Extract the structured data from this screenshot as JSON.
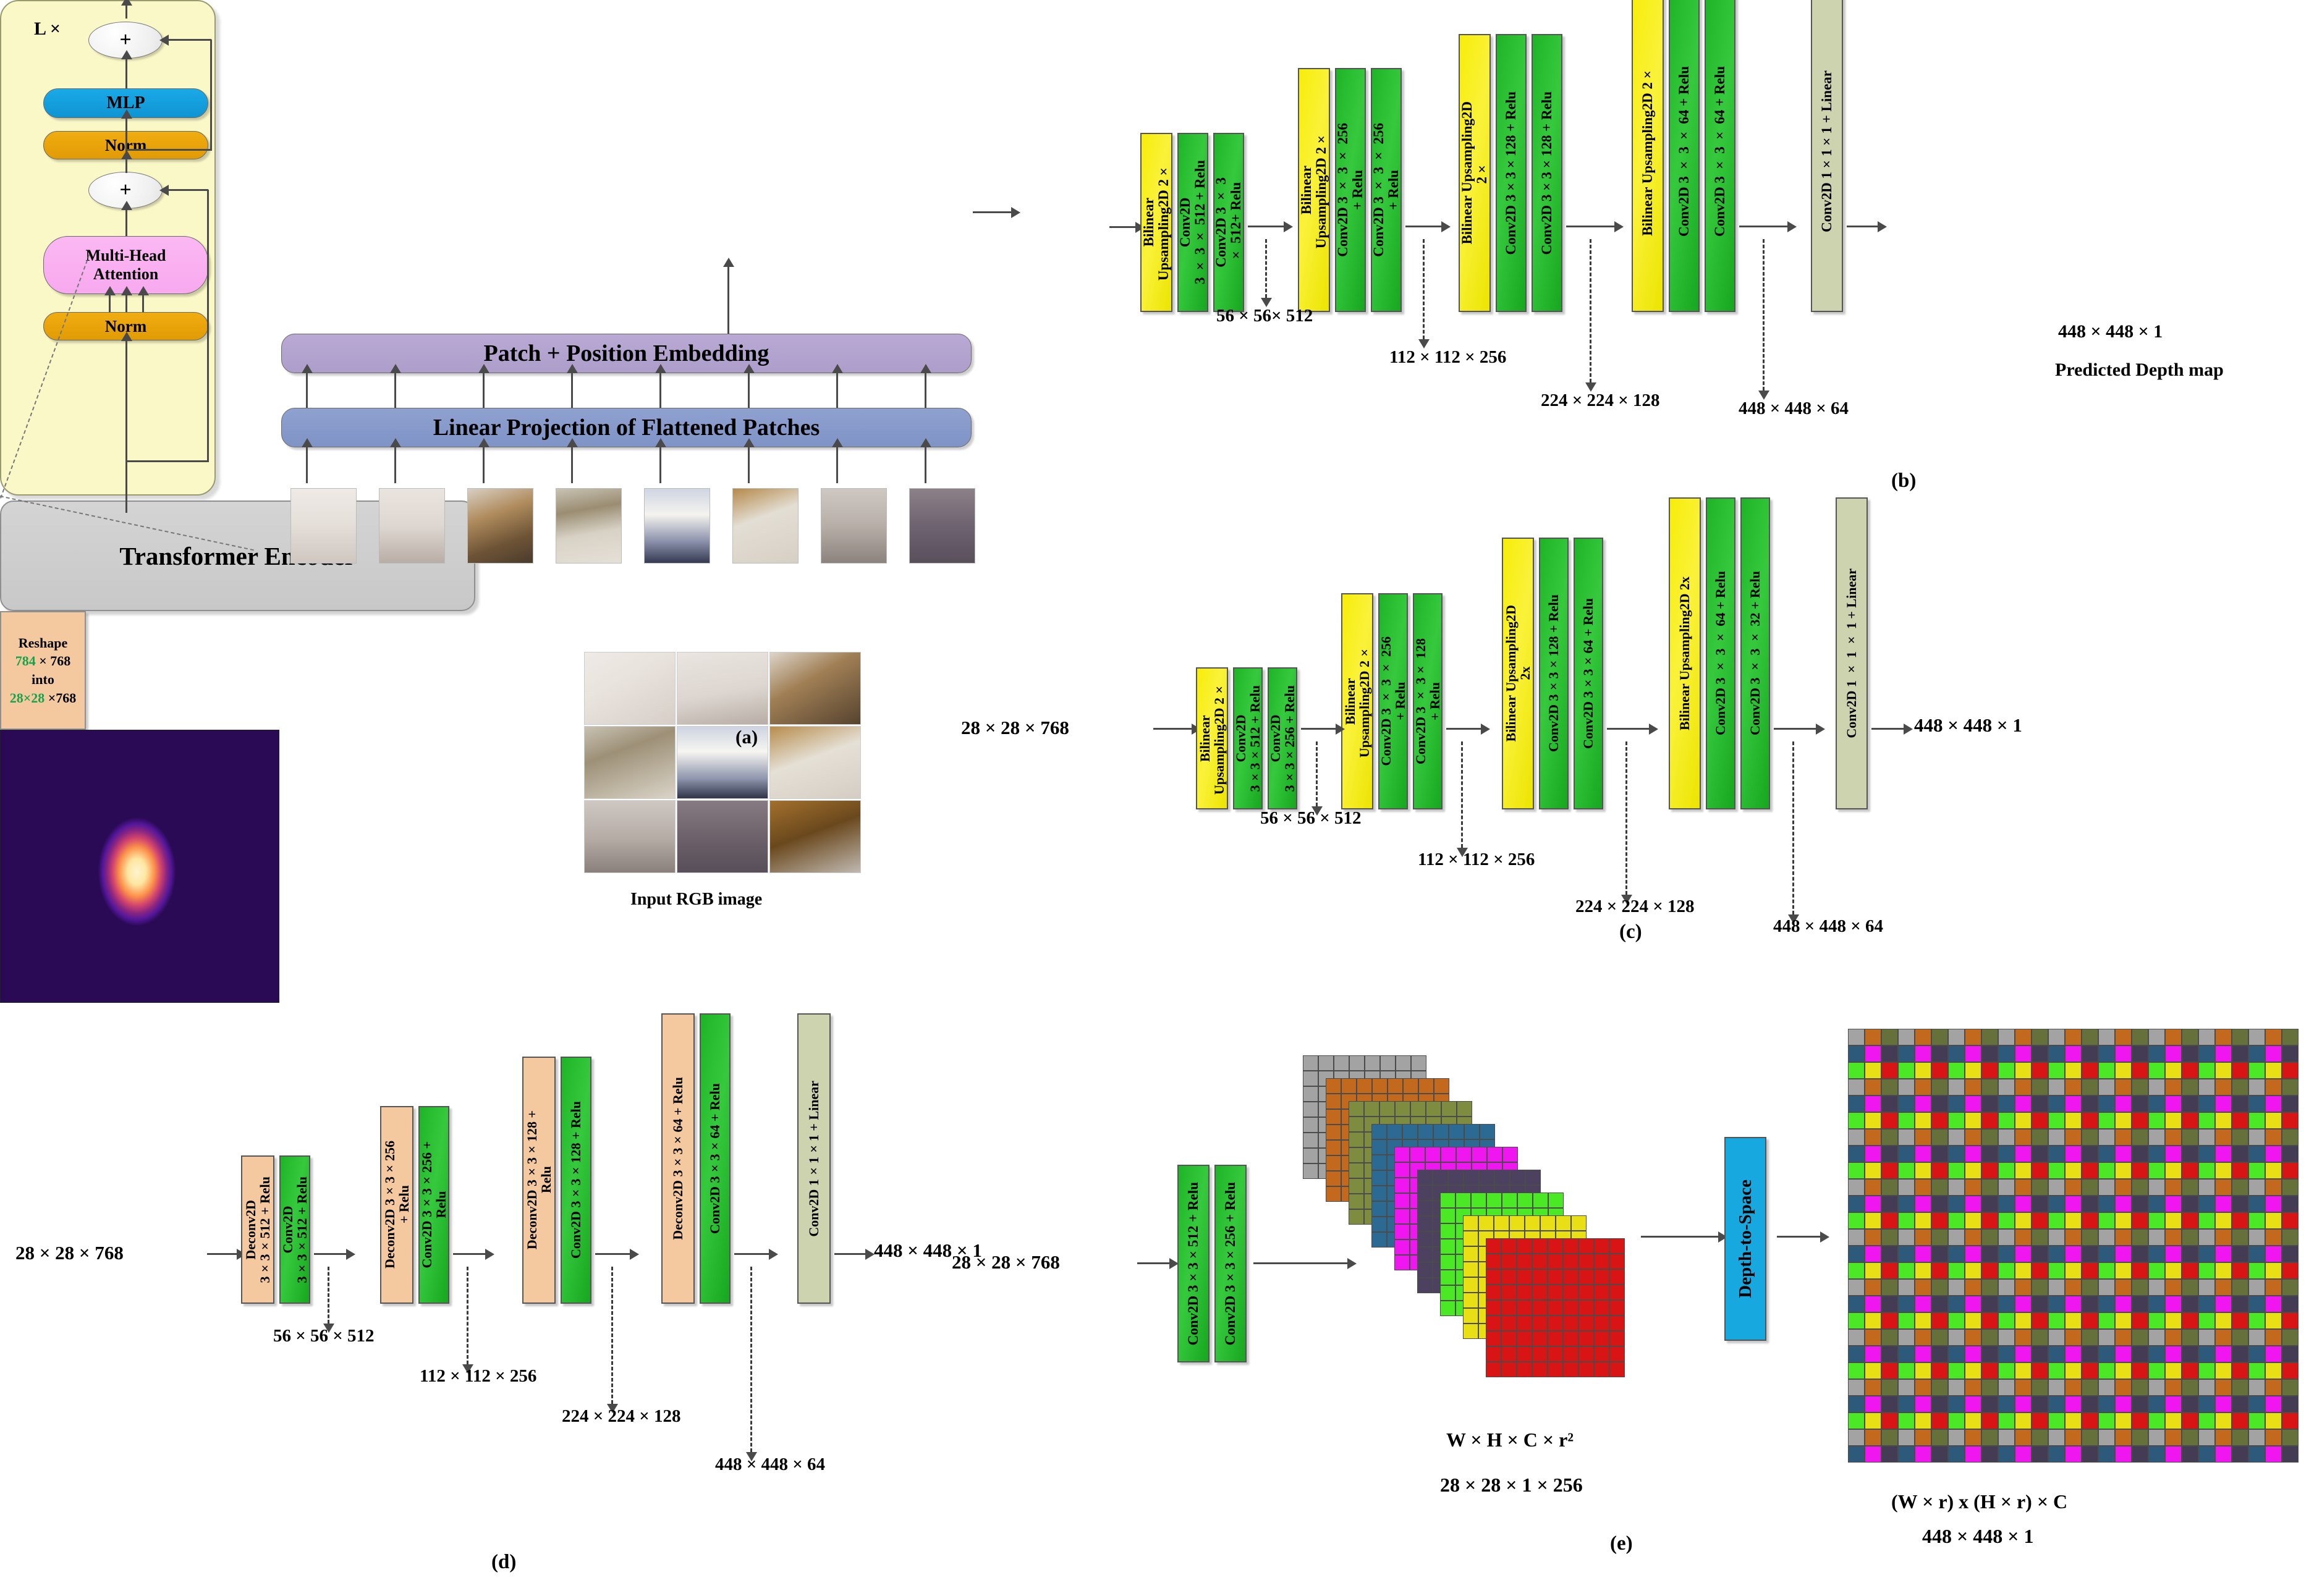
{
  "figure": {
    "panels": [
      "(a)",
      "(b)",
      "(c)",
      "(d)",
      "(e)"
    ]
  },
  "panel_a": {
    "label": "(a)",
    "repeat_label": "L ×",
    "blocks": {
      "mlp": "MLP",
      "norm_top": "Norm",
      "norm_bottom": "Norm",
      "attention": "Multi-Head\nAttention",
      "add_top": "+",
      "add_bottom": "+"
    },
    "encoder_title": "Transformer Encoder",
    "patch_embedding": "Patch + Position Embedding",
    "linear_projection": "Linear Projection of Flattened Patches",
    "input_caption": "Input RGB image",
    "reshape": {
      "line1": "Reshape",
      "line2a": "784",
      "line2b": " × 768",
      "line3": "into",
      "line4a": "28×28",
      "line4b": " ×768",
      "highlight_color": "#16a34a"
    }
  },
  "panel_b": {
    "label": "(b)",
    "blocks": [
      {
        "text": "Bilinear\nUpsampling2D  2×",
        "color": "yellow"
      },
      {
        "text": "Conv2D\n3 × 3 × 512 + Relu",
        "color": "green"
      },
      {
        "text": "Conv2D 3 × 3\n× 512+ Relu",
        "color": "green"
      },
      {
        "text": "Bilinear\nUpsampling2D  2×",
        "color": "yellow"
      },
      {
        "text": "Conv2D 3 × 3 × 256\n+ Relu",
        "color": "green"
      },
      {
        "text": "Conv2D 3 × 3 × 256\n+ Relu",
        "color": "green"
      },
      {
        "text": "Bilinear Upsampling2D\n2×",
        "color": "yellow"
      },
      {
        "text": "Conv2D 3×3×128 + Relu",
        "color": "green"
      },
      {
        "text": "Conv2D 3×3×128 + Relu",
        "color": "green"
      },
      {
        "text": "Bilinear Upsampling2D 2×",
        "color": "yellow"
      },
      {
        "text": "Conv2D 3 × 3 × 64 + Relu",
        "color": "green"
      },
      {
        "text": "Conv2D 3 × 3 × 64 + Relu",
        "color": "green"
      },
      {
        "text": "Conv2D 1×1×1 + Linear",
        "color": "olive"
      }
    ],
    "dims": [
      "56 × 56× 512",
      "112 × 112 × 256",
      "224 × 224 × 128",
      "448 × 448 × 64"
    ],
    "output_dim": "448 × 448 × 1",
    "output_caption": "Predicted Depth map"
  },
  "panel_c": {
    "label": "(c)",
    "input_dim": "28 × 28 × 768",
    "blocks": [
      {
        "text": "Bilinear\nUpsampling2D  2×",
        "color": "yellow"
      },
      {
        "text": "Conv2D\n3×3×512 + Relu",
        "color": "green"
      },
      {
        "text": "Conv2D\n3×3×256 + Relu",
        "color": "green"
      },
      {
        "text": "Bilinear\nUpsampling2D  2×",
        "color": "yellow"
      },
      {
        "text": "Conv2D 3 × 3 × 256\n+ Relu",
        "color": "green"
      },
      {
        "text": "Conv2D 3 × 3× 128\n+ Relu",
        "color": "green"
      },
      {
        "text": "Bilinear Upsampling2D\n2x",
        "color": "yellow"
      },
      {
        "text": "Conv2D 3×3×128 + Relu",
        "color": "green"
      },
      {
        "text": "Conv2D 3×3×64 + Relu",
        "color": "green"
      },
      {
        "text": "Bilinear Upsampling2D 2x",
        "color": "yellow"
      },
      {
        "text": "Conv2D 3 × 3 × 64 + Relu",
        "color": "green"
      },
      {
        "text": "Conv2D 3 × 3 × 32 + Relu",
        "color": "green"
      },
      {
        "text": "Conv2D 1 × 1 × 1 + Linear",
        "color": "olive"
      }
    ],
    "dims": [
      "56 × 56 × 512",
      "112 × 112 × 256",
      "224 × 224 × 128",
      "448 × 448 × 64"
    ],
    "output_dim": "448 × 448 × 1"
  },
  "panel_d": {
    "label": "(d)",
    "input_dim": "28 × 28 × 768",
    "blocks": [
      {
        "text": "Deconv2D\n3×3×512 + Relu",
        "color": "peach"
      },
      {
        "text": "Conv2D\n3×3×512 + Relu",
        "color": "green"
      },
      {
        "text": "Deconv2D 3×3×256\n+ Relu",
        "color": "peach"
      },
      {
        "text": "Conv2D 3×3×256 +\nRelu",
        "color": "green"
      },
      {
        "text": "Deconv2D 3×3×128 +\nRelu",
        "color": "peach"
      },
      {
        "text": "Conv2D 3×3×128 + Relu",
        "color": "green"
      },
      {
        "text": "Deconv2D 3×3×64 + Relu",
        "color": "peach"
      },
      {
        "text": "Conv2D 3×3×64 + Relu",
        "color": "green"
      },
      {
        "text": "Conv2D 1×1×1 + Linear",
        "color": "olive"
      }
    ],
    "dims": [
      "56 × 56 × 512",
      "112 × 112 × 256",
      "224 × 224 × 128",
      "448 × 448 × 64"
    ],
    "output_dim": "448 × 448 × 1"
  },
  "panel_e": {
    "label": "(e)",
    "input_dim": "28 × 28 × 768",
    "blocks": [
      {
        "text": "Conv2D 3×3×512 + Relu",
        "color": "green"
      },
      {
        "text": "Conv2D 3×3×256 + Relu",
        "color": "green"
      }
    ],
    "depth_to_space_label": "Depth-to-Space",
    "stack_caption_line1": "W × H × C × r²",
    "stack_caption_line2": "28 × 28 × 1 × 256",
    "mosaic_caption_line1": "(W × r) x (H × r) × C",
    "mosaic_caption_line2": "448 × 448 × 1",
    "stack_colors": [
      "#a3a3a3",
      "#c2691d",
      "#7d8c3f",
      "#2d6a93",
      "#ef16ef",
      "#4c4260",
      "#4ae825",
      "#e8e014",
      "#d91414"
    ],
    "mosaic_colors": [
      "#a3a3a3",
      "#c2691d",
      "#66703a",
      "#2d5a7a",
      "#ef16ef",
      "#443c55",
      "#4ae825",
      "#e8e014",
      "#d91414"
    ]
  }
}
